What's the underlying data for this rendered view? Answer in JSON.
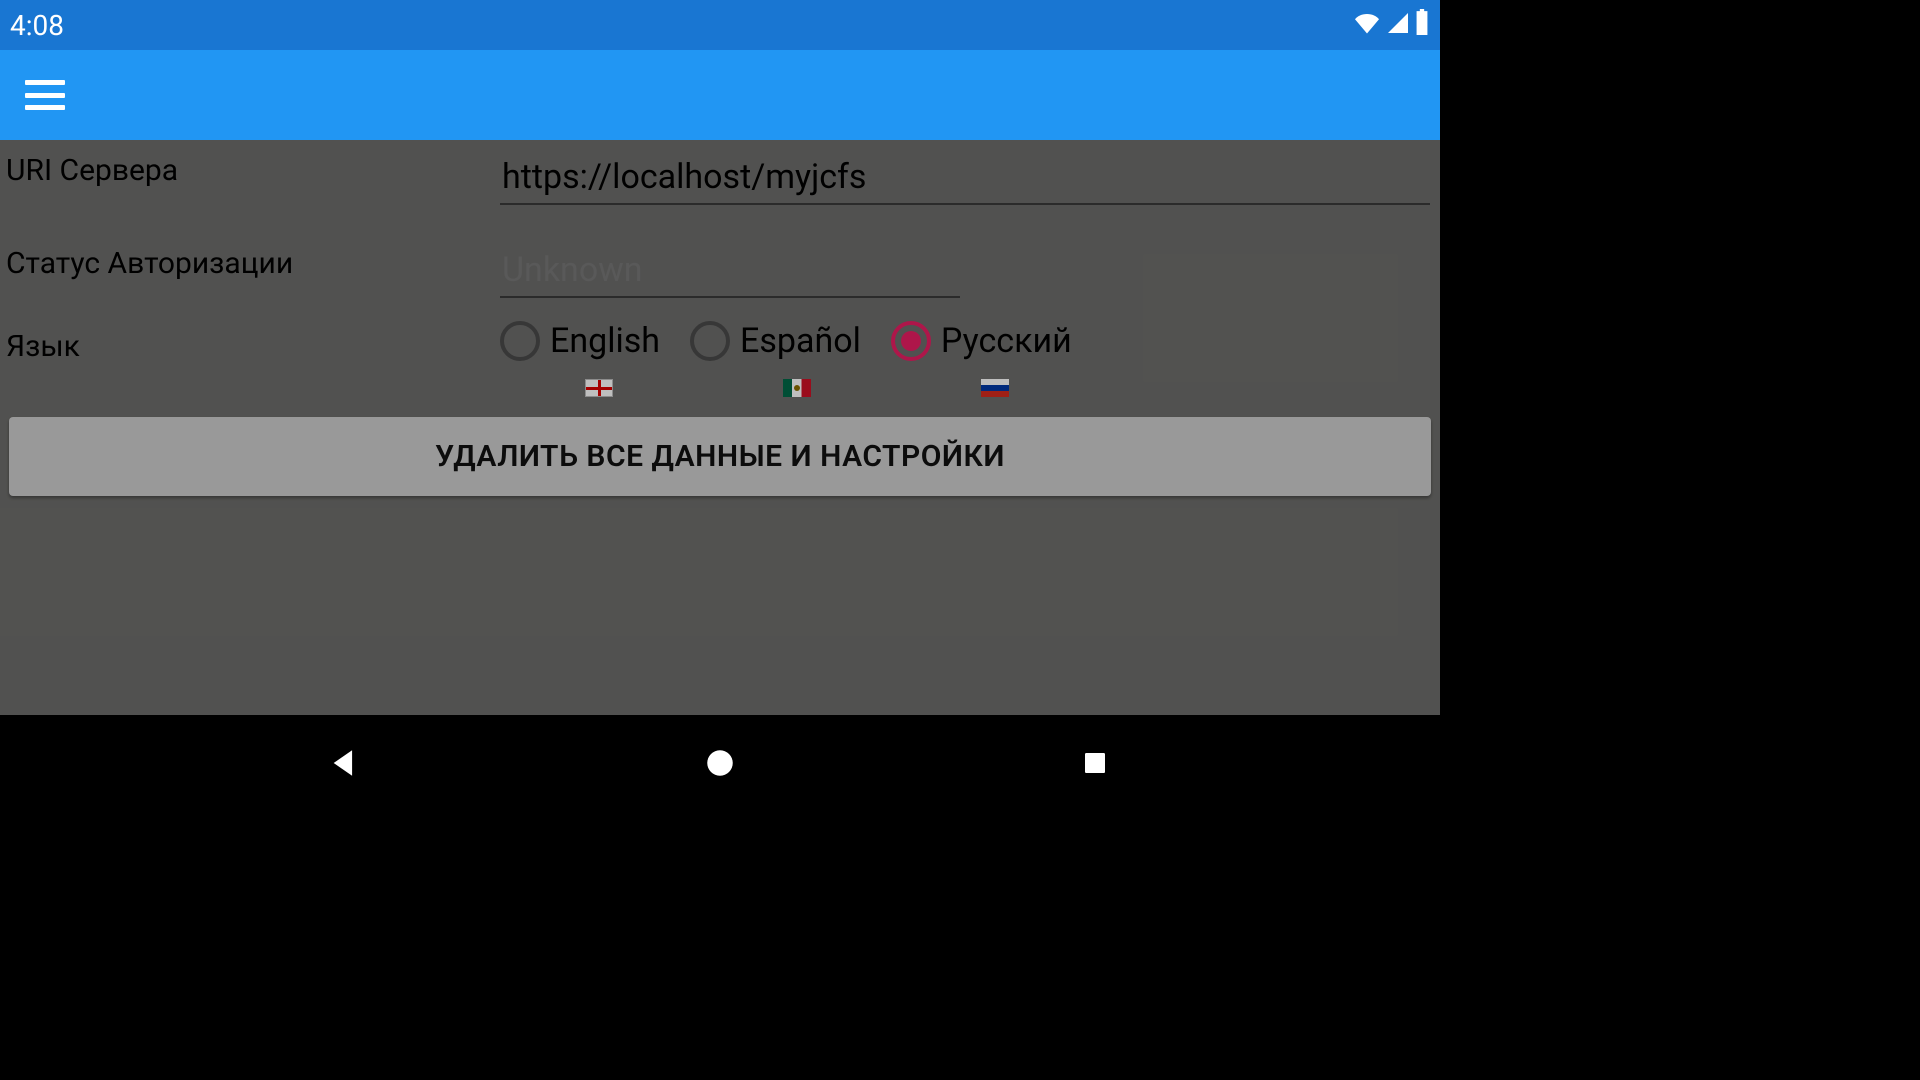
{
  "statusbar": {
    "time": "4:08"
  },
  "form": {
    "server_uri_label": "URI Сервера",
    "server_uri_value": "https://localhost/myjcfs",
    "auth_status_label": "Статус Авторизации",
    "auth_status_value": "Unknown",
    "language_label": "Язык"
  },
  "languages": {
    "options": [
      {
        "label": "English",
        "selected": false,
        "flag": "eng"
      },
      {
        "label": "Español",
        "selected": false,
        "flag": "mex"
      },
      {
        "label": "Русский",
        "selected": true,
        "flag": "rus"
      }
    ]
  },
  "buttons": {
    "clear_all": "УДАЛИТЬ ВСЕ ДАННЫЕ И НАСТРОЙКИ"
  }
}
